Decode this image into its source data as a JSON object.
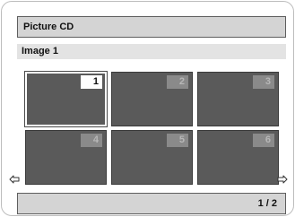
{
  "title": "Picture CD",
  "image_label": "Image 1",
  "thumbnails": [
    {
      "number": "1",
      "selected": true
    },
    {
      "number": "2",
      "selected": false
    },
    {
      "number": "3",
      "selected": false
    },
    {
      "number": "4",
      "selected": false
    },
    {
      "number": "5",
      "selected": false
    },
    {
      "number": "6",
      "selected": false
    }
  ],
  "navigation": {
    "prev_icon": "left-arrow-icon",
    "next_icon": "right-arrow-icon"
  },
  "page_indicator": "1 / 2",
  "colors": {
    "bar_fill": "#d4d4d4",
    "thumbnail_fill": "#5a5a5a",
    "selected_border": "#ffffff"
  }
}
